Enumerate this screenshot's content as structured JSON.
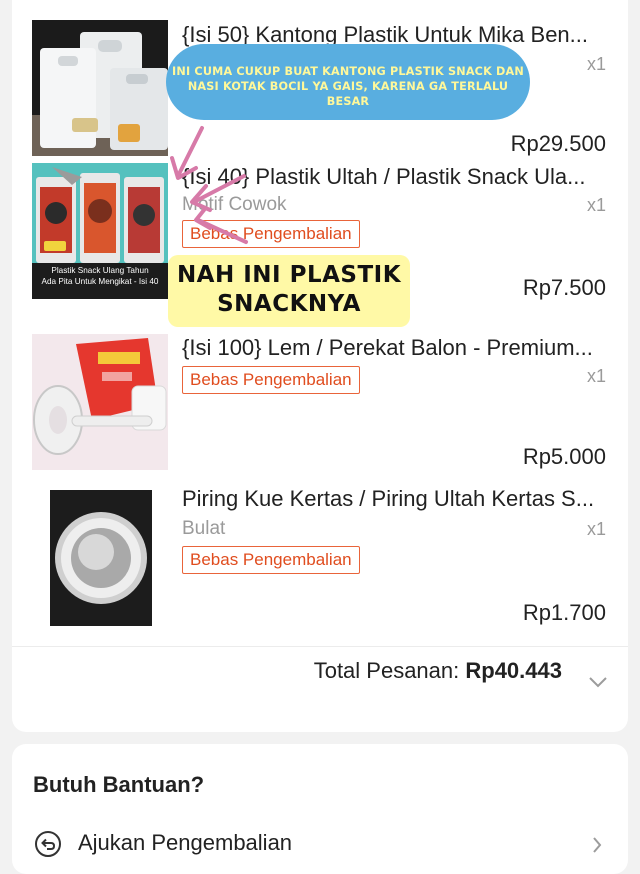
{
  "order": {
    "items": [
      {
        "name": "{Isi 50} Kantong Plastik Untuk Mika Ben...",
        "variant": "",
        "qty": "x1",
        "badge": "",
        "price": "Rp29.500"
      },
      {
        "name": "{Isi 40} Plastik Ultah / Plastik Snack Ula...",
        "variant": "Motif Cowok",
        "qty": "x1",
        "badge": "Bebas Pengembalian",
        "price": "Rp7.500",
        "image_text": "Plastik Snack Ulang Tahun\nAda Pita Untuk Mengikat - Isi 40"
      },
      {
        "name": "{Isi 100} Lem / Perekat Balon - Premium...",
        "variant": "",
        "qty": "x1",
        "badge": "Bebas Pengembalian",
        "price": "Rp5.000"
      },
      {
        "name": "Piring Kue Kertas / Piring Ultah Kertas S...",
        "variant": "Bulat",
        "qty": "x1",
        "badge": "Bebas Pengembalian",
        "price": "Rp1.700"
      }
    ],
    "total_label": "Total Pesanan:",
    "total_value": "Rp40.443"
  },
  "help": {
    "title": "Butuh Bantuan?",
    "refund_label": "Ajukan Pengembalian"
  },
  "annotations": {
    "bubble_text": "Ini cuma cukup buat kantong plastik snack dan nasi kotak bocil ya gais, karena ga terlalu besar",
    "sticky_text": "NAH INI PLASTIK SNACKNYA"
  },
  "colors": {
    "accent": "#e04d1f",
    "bubble": "#59aee0",
    "sticky": "#fff9a6",
    "arrow": "#d77aa8"
  },
  "icons": [
    "chevron-down-icon",
    "return-icon",
    "chevron-right-icon"
  ]
}
